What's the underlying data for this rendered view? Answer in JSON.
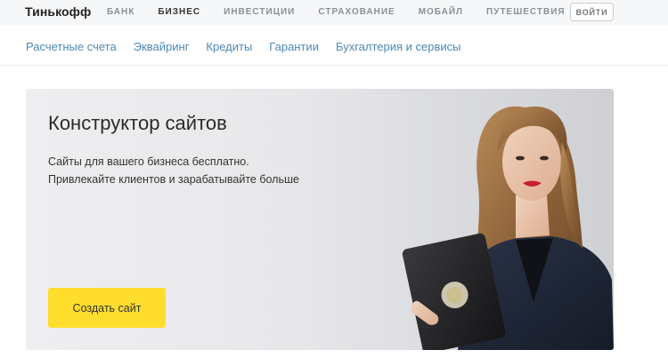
{
  "brand": {
    "logo_text": "Тинькофф"
  },
  "top_nav": {
    "items": [
      {
        "label": "БАНК"
      },
      {
        "label": "БИЗНЕС"
      },
      {
        "label": "ИНВЕСТИЦИИ"
      },
      {
        "label": "СТРАХОВАНИЕ"
      },
      {
        "label": "МОБАЙЛ"
      },
      {
        "label": "ПУТЕШЕСТВИЯ"
      }
    ],
    "active_index": 1,
    "login_label": "ВОЙТИ"
  },
  "sub_nav": {
    "items": [
      {
        "label": "Расчетные счета"
      },
      {
        "label": "Эквайринг"
      },
      {
        "label": "Кредиты"
      },
      {
        "label": "Гарантии"
      },
      {
        "label": "Бухгалтерия и сервисы"
      }
    ]
  },
  "hero": {
    "title": "Конструктор сайтов",
    "description_line_1": "Сайты для вашего бизнеса бесплатно.",
    "description_line_2": "Привлекайте клиентов и зарабатывайте больше",
    "cta_label": "Создать сайт",
    "image": "woman-holding-tablet-photo"
  },
  "colors": {
    "accent_yellow": "#ffdd2d",
    "link_blue": "#4e88b5",
    "topbar_bg": "#f6f7f8",
    "hero_bg": "#e8e8eb"
  }
}
